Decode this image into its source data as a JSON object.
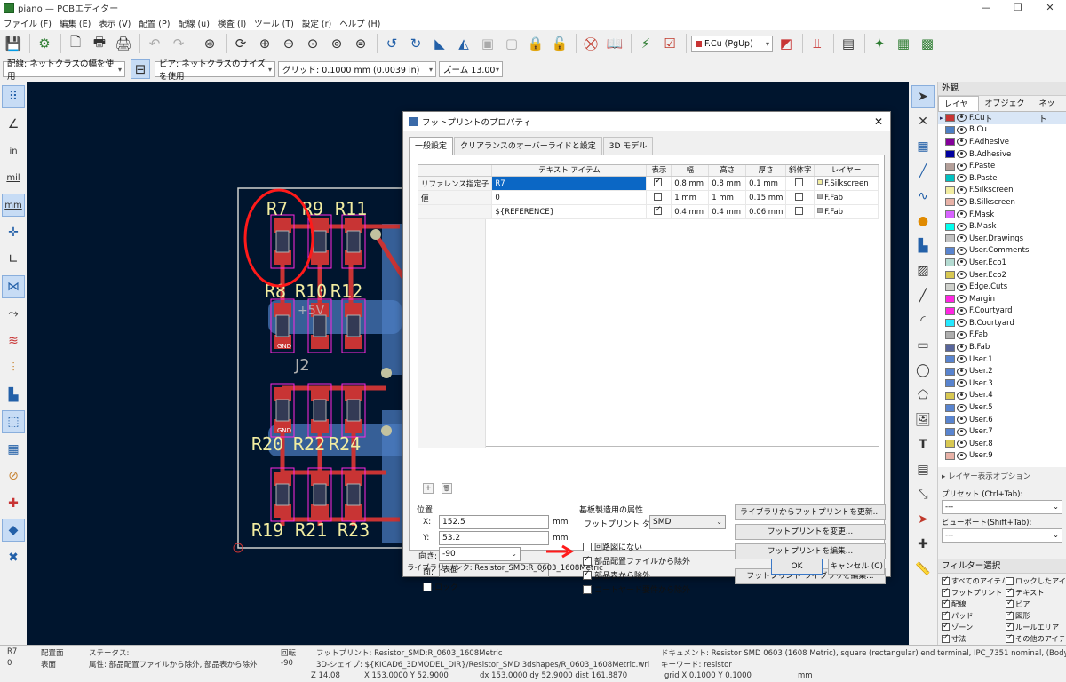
{
  "window": {
    "title": "piano — PCBエディター",
    "controls": [
      "—",
      "❐",
      "✕"
    ]
  },
  "menu": [
    "ファイル (F)",
    "編集 (E)",
    "表示 (V)",
    "配置 (P)",
    "配線 (u)",
    "検査 (I)",
    "ツール (T)",
    "設定 (r)",
    "ヘルプ (H)"
  ],
  "toolbar": {
    "layer_select": "F.Cu (PgUp)",
    "track_width": "配線: ネットクラスの幅を使用",
    "via_size": "ビア: ネットクラスのサイズを使用",
    "grid": "グリッド: 0.1000 mm (0.0039 in)",
    "zoom": "ズーム 13.00"
  },
  "left_toolbar": {
    "inch_label": "in",
    "mil_label": "mil",
    "mm_label": "mm"
  },
  "pcb": {
    "refdes": [
      "R7",
      "R9",
      "R11",
      "R8",
      "R10",
      "R12",
      "R20",
      "R22",
      "R24",
      "R19",
      "R21",
      "R23"
    ],
    "net_labels": [
      "GND",
      "+5V",
      "J2",
      "GND"
    ]
  },
  "dialog": {
    "title": "フットプリントのプロパティ",
    "close": "✕",
    "tabs": [
      "一般設定",
      "クリアランスのオーバーライドと設定",
      "3D モデル"
    ],
    "grid": {
      "headers": [
        "テキスト アイテム",
        "表示",
        "幅",
        "高さ",
        "厚さ",
        "斜体字",
        "レイヤー"
      ],
      "rows": [
        {
          "label": "リファレンス指定子",
          "text": "R7",
          "show": true,
          "width": "0.8 mm",
          "height": "0.8 mm",
          "thickness": "0.1 mm",
          "italic": false,
          "layer": "F.Silkscreen",
          "layer_color": "#f2eda1"
        },
        {
          "label": "値",
          "text": "0",
          "show": false,
          "width": "1 mm",
          "height": "1 mm",
          "thickness": "0.15 mm",
          "italic": false,
          "layer": "F.Fab",
          "layer_color": "#afafaf"
        },
        {
          "label": "",
          "text": "${REFERENCE}",
          "show": true,
          "width": "0.4 mm",
          "height": "0.4 mm",
          "thickness": "0.06 mm",
          "italic": false,
          "layer": "F.Fab",
          "layer_color": "#afafaf"
        }
      ],
      "add_btn": "+",
      "del_btn": "🗑"
    },
    "position": {
      "section": "位置",
      "x_label": "X:",
      "x_value": "152.5",
      "x_unit": "mm",
      "y_label": "Y:",
      "y_value": "53.2",
      "y_unit": "mm",
      "orient_label": "向き:",
      "orient_value": "-90",
      "side_label": "面:",
      "side_value": "表面",
      "lock_label": "ロック"
    },
    "fab": {
      "section": "基板製造用の属性",
      "type_label": "フットプリント タイプ:",
      "type_value": "SMD",
      "checks": [
        {
          "label": "回路図にない",
          "checked": false
        },
        {
          "label": "部品配置ファイルから除外",
          "checked": true
        },
        {
          "label": "部品表から除外",
          "checked": true
        },
        {
          "label": "コートヤード要件から除外",
          "checked": false
        }
      ]
    },
    "buttons": {
      "update": "ライブラリからフットプリントを更新...",
      "change": "フットプリントを変更...",
      "edit": "フットプリントを編集...",
      "edit_lib": "フットプリント ライブラリを編集...",
      "ok": "OK",
      "cancel": "キャンセル (C)"
    },
    "library_link": "ライブラリ リンク: Resistor_SMD:R_0603_1608Metric"
  },
  "right_panel": {
    "appearance": "外観",
    "tabs": [
      "レイヤー",
      "オブジェクト",
      "ネット"
    ],
    "layers": [
      {
        "name": "F.Cu",
        "color": "#c83434"
      },
      {
        "name": "B.Cu",
        "color": "#4d7fc4"
      },
      {
        "name": "F.Adhesive",
        "color": "#84009a"
      },
      {
        "name": "B.Adhesive",
        "color": "#0000a0"
      },
      {
        "name": "F.Paste",
        "color": "#b4a09a"
      },
      {
        "name": "B.Paste",
        "color": "#00c2c2"
      },
      {
        "name": "F.Silkscreen",
        "color": "#f2eda1"
      },
      {
        "name": "B.Silkscreen",
        "color": "#e8b2a7"
      },
      {
        "name": "F.Mask",
        "color": "#d864ff"
      },
      {
        "name": "B.Mask",
        "color": "#02ffee"
      },
      {
        "name": "User.Drawings",
        "color": "#c2c2c2"
      },
      {
        "name": "User.Comments",
        "color": "#5984cf"
      },
      {
        "name": "User.Eco1",
        "color": "#b4dbd2"
      },
      {
        "name": "User.Eco2",
        "color": "#d8c852"
      },
      {
        "name": "Edge.Cuts",
        "color": "#d0d2cd"
      },
      {
        "name": "Margin",
        "color": "#ff26e2"
      },
      {
        "name": "F.Courtyard",
        "color": "#ff26e2"
      },
      {
        "name": "B.Courtyard",
        "color": "#26e9ff"
      },
      {
        "name": "F.Fab",
        "color": "#afafaf"
      },
      {
        "name": "B.Fab",
        "color": "#58659b"
      },
      {
        "name": "User.1",
        "color": "#5984cf"
      },
      {
        "name": "User.2",
        "color": "#5984cf"
      },
      {
        "name": "User.3",
        "color": "#5984cf"
      },
      {
        "name": "User.4",
        "color": "#d8c852"
      },
      {
        "name": "User.5",
        "color": "#5984cf"
      },
      {
        "name": "User.6",
        "color": "#5984cf"
      },
      {
        "name": "User.7",
        "color": "#5984cf"
      },
      {
        "name": "User.8",
        "color": "#d8c852"
      },
      {
        "name": "User.9",
        "color": "#e8b2a7"
      }
    ],
    "layer_options": "▸ レイヤー表示オプション",
    "preset_label": "プリセット (Ctrl+Tab):",
    "preset_value": "---",
    "viewport_label": "ビューポート(Shift+Tab):",
    "viewport_value": "---",
    "filter_title": "フィルター選択",
    "filters": [
      {
        "label": "すべてのアイテム",
        "checked": true
      },
      {
        "label": "ロックしたアイテム",
        "checked": false
      },
      {
        "label": "フットプリント",
        "checked": true
      },
      {
        "label": "テキスト",
        "checked": true
      },
      {
        "label": "配線",
        "checked": true
      },
      {
        "label": "ビア",
        "checked": true
      },
      {
        "label": "パッド",
        "checked": true
      },
      {
        "label": "図形",
        "checked": true
      },
      {
        "label": "ゾーン",
        "checked": true
      },
      {
        "label": "ルールエリア",
        "checked": true
      },
      {
        "label": "寸法",
        "checked": true
      },
      {
        "label": "その他のアイテム",
        "checked": true
      }
    ]
  },
  "status": {
    "ref": "R7",
    "ref_val": "0",
    "placement_h": "配置面",
    "placement_v": "表面",
    "status_h": "ステータス:",
    "status_v": "属性: 部品配置ファイルから除外, 部品表から除外",
    "rotation_h": "回転",
    "rotation_v": "-90",
    "footprint": "フットプリント: Resistor_SMD:R_0603_1608Metric",
    "shape3d": "3D-シェイプ: ${KICAD6_3DMODEL_DIR}/Resistor_SMD.3dshapes/R_0603_1608Metric.wrl",
    "doc": "ドキュメント: Resistor SMD 0603 (1608 Metric), square (rectangular) end terminal, IPC_7351 nominal, (Body siz",
    "keywords": "キーワード: resistor",
    "zoom": "Z 14.08",
    "xy": "X 153.0000  Y 52.9000",
    "dxy": "dx 153.0000  dy 52.9000  dist 161.8870",
    "grid": "grid X 0.1000  Y 0.1000",
    "unit": "mm"
  }
}
